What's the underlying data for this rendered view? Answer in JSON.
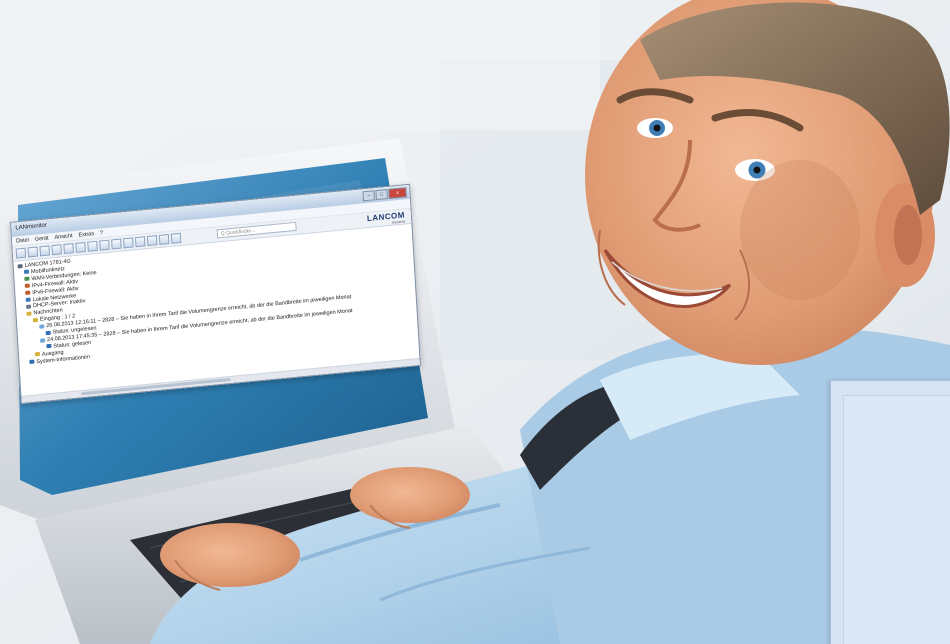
{
  "window": {
    "title": "LANmonitor",
    "buttons": [
      "–",
      "□",
      "x"
    ]
  },
  "menubar": [
    "Datei",
    "Gerät",
    "Ansicht",
    "Extras",
    "?"
  ],
  "toolbar": {
    "search_placeholder": "Q Quickfinder..."
  },
  "brand": {
    "logo": "LANCOM",
    "sub": "Systems"
  },
  "tree": [
    {
      "level": 0,
      "label": "LANCOM 1781-4G",
      "icon": "device-icon"
    },
    {
      "level": 1,
      "label": "Mobilfunknetz",
      "icon": "signal-icon"
    },
    {
      "level": 1,
      "label": "WAN-Verbindungen: Keine",
      "icon": "network-icon"
    },
    {
      "level": 1,
      "label": "IPv4-Firewall: Aktiv",
      "icon": "firewall-icon"
    },
    {
      "level": 1,
      "label": "IPv6-Firewall: Aktiv",
      "icon": "firewall-icon"
    },
    {
      "level": 1,
      "label": "Lokale Netzwerke",
      "icon": "lan-icon"
    },
    {
      "level": 1,
      "label": "DHCP-Server: Inaktiv",
      "icon": "server-icon"
    },
    {
      "level": 1,
      "label": "Nachrichten",
      "icon": "mail-icon"
    },
    {
      "level": 2,
      "label": "Eingang : 1 / 2",
      "icon": "inbox-icon"
    },
    {
      "level": 3,
      "label": "26.08.2013 12:16:11 – 2828 – Sie haben in Ihrem Tarif die Volumengrenze erreicht, ab der die Bandbreite im jeweiligen Monat",
      "icon": "message-icon"
    },
    {
      "level": 4,
      "label": "Status: ungelesen",
      "icon": "info-icon"
    },
    {
      "level": 3,
      "label": "24.08.2013 17:45:35 – 2828 – Sie haben in Ihrem Tarif die Volumengrenze erreicht, ab der die Bandbreite im jeweiligen Monat",
      "icon": "message-icon"
    },
    {
      "level": 4,
      "label": "Status: gelesen",
      "icon": "info-icon"
    },
    {
      "level": 2,
      "label": "Ausgang",
      "icon": "outbox-icon"
    },
    {
      "level": 1,
      "label": "System-Informationen",
      "icon": "info-icon"
    }
  ],
  "colors": {
    "wall": "#eef1f4",
    "screen": "#2f7fb3",
    "shirt": "#bcd9ee",
    "accent": "#1f3b72",
    "panel": "#d5e3f3"
  }
}
